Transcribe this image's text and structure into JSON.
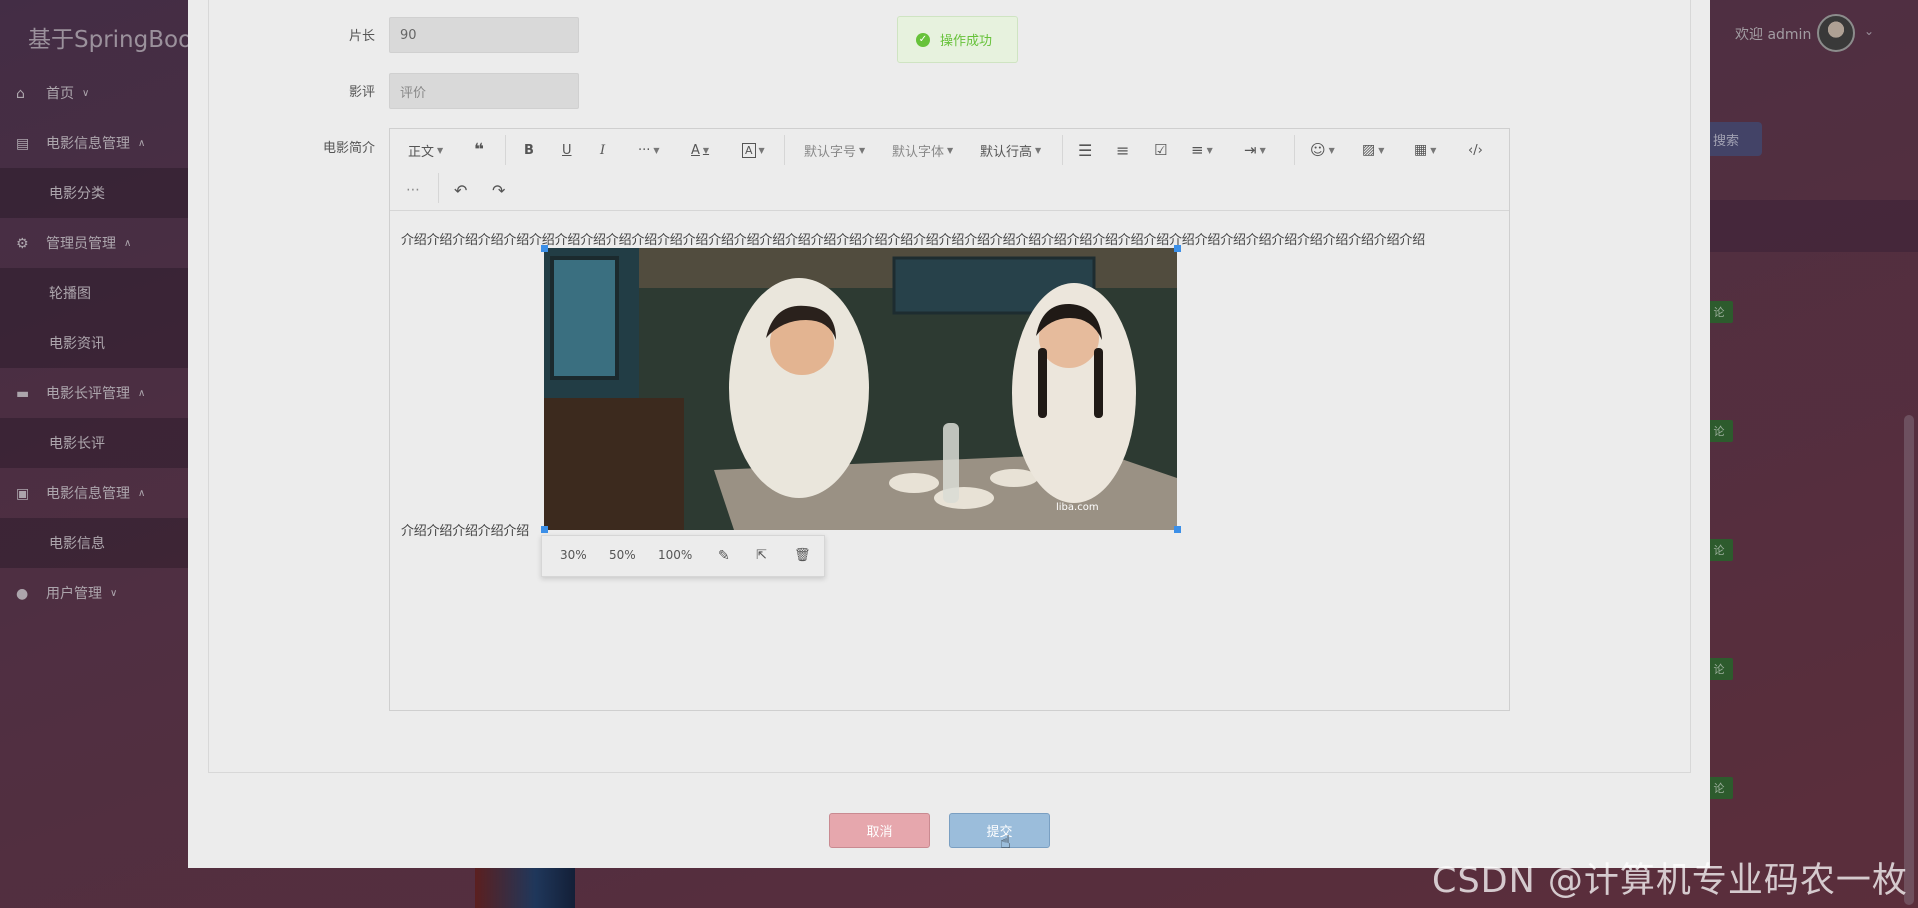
{
  "app": {
    "brand": "基于SpringBoo",
    "welcome": "欢迎 admin"
  },
  "sidebar": {
    "items": [
      {
        "label": "首页",
        "icon": "home-icon",
        "caret": "⌄"
      },
      {
        "label": "电影信息管理",
        "icon": "tray-icon",
        "caret": "⌃"
      },
      {
        "label": "电影分类",
        "sub": true
      },
      {
        "label": "管理员管理",
        "icon": "gear-icon",
        "caret": "⌃"
      },
      {
        "label": "轮播图",
        "sub": true
      },
      {
        "label": "电影资讯",
        "sub": true
      },
      {
        "label": "电影长评管理",
        "icon": "card-icon",
        "caret": "⌃"
      },
      {
        "label": "电影长评",
        "sub": true
      },
      {
        "label": "电影信息管理",
        "icon": "wallet-icon",
        "caret": "⌃"
      },
      {
        "label": "电影信息",
        "sub": true
      },
      {
        "label": "用户管理",
        "icon": "user-icon",
        "caret": "⌄"
      }
    ]
  },
  "background": {
    "search_label": "搜索",
    "tag_label": "论"
  },
  "toast": {
    "message": "操作成功",
    "icon": "check-circle-icon",
    "color": "#67c23a"
  },
  "form": {
    "duration_label": "片长",
    "duration_value": "90",
    "review_label": "影评",
    "review_placeholder": "评价",
    "intro_label": "电影简介"
  },
  "editor": {
    "toolbar": {
      "paragraph": "正文",
      "quote_icon": "quote-icon",
      "bold_icon": "bold-icon",
      "underline_icon": "underline-icon",
      "italic_icon": "italic-icon",
      "more": "···",
      "font_color": "A",
      "bg_color": "A",
      "font_size": "默认字号",
      "font_family": "默认字体",
      "line_height": "默认行高",
      "bullet_list_icon": "bullet-list-icon",
      "numbered_list_icon": "numbered-list-icon",
      "todo_icon": "checkbox-icon",
      "align_icon": "align-left-icon",
      "indent_icon": "indent-icon",
      "emoji_icon": "emoji-icon",
      "image_icon": "image-icon",
      "table_icon": "table-icon",
      "code_icon": "code-icon",
      "divider_icon": "divider-icon",
      "undo_icon": "undo-icon",
      "redo_icon": "redo-icon"
    },
    "content_line1": "介绍介绍介绍介绍介绍介绍介绍介绍介绍介绍介绍介绍介绍介绍介绍介绍介绍介绍介绍介绍介绍介绍介绍介绍介绍介绍介绍介绍介绍介绍介绍介绍介绍介绍介绍介绍介绍介绍介绍介绍",
    "content_line2": "介绍介绍介绍介绍介绍",
    "image_watermark": "liba.com",
    "image_tools": {
      "w30": "30%",
      "w50": "50%",
      "w100": "100%"
    }
  },
  "buttons": {
    "cancel": "取消",
    "submit": "提交"
  },
  "watermark": "CSDN @计算机专业码农一枚"
}
